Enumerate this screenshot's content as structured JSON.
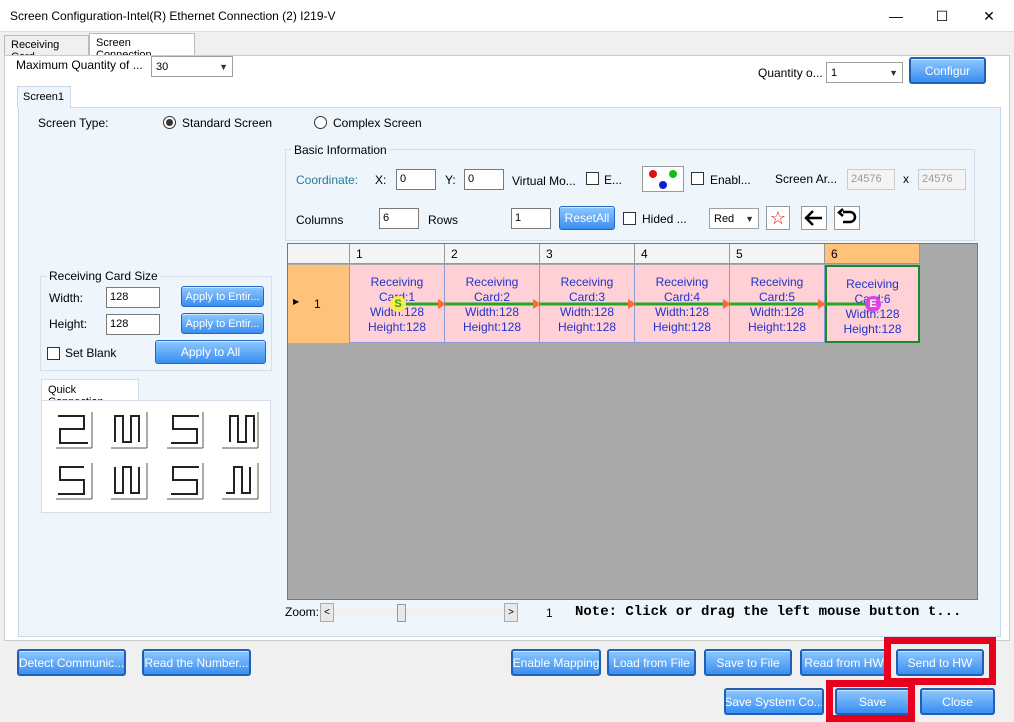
{
  "window": {
    "title": "Screen Configuration-Intel(R) Ethernet Connection (2) I219-V",
    "minimize": "—",
    "maximize": "☐",
    "close": "✕"
  },
  "tabs": [
    "Receiving Card",
    "Screen Connection"
  ],
  "top": {
    "max_qty_label": "Maximum Quantity of ...",
    "max_qty_value": "30",
    "qty_label": "Quantity o...",
    "qty_value": "1",
    "configure": "Configur"
  },
  "screen_tab": "Screen1",
  "screen_type": {
    "label": "Screen Type:",
    "standard": "Standard Screen",
    "complex": "Complex Screen",
    "selected": "standard"
  },
  "basic": {
    "title": "Basic Information",
    "coordinate": "Coordinate:",
    "x_label": "X:",
    "x": "0",
    "y_label": "Y:",
    "y": "0",
    "virtual": "Virtual Mo...",
    "e_label": "E...",
    "enable_label": "Enabl...",
    "screen_area": "Screen Ar...",
    "area_w": "24576",
    "x_sep": "x",
    "area_h": "24576",
    "columns_label": "Columns",
    "columns": "6",
    "rows_label": "Rows",
    "rows": "1",
    "reset_all": "ResetAll",
    "hided": "Hided ...",
    "color": "Red"
  },
  "card_size": {
    "title": "Receiving Card Size",
    "width_label": "Width:",
    "width": "128",
    "height_label": "Height:",
    "height": "128",
    "apply_entire_w": "Apply to Entir...",
    "apply_entire_h": "Apply to Entir...",
    "set_blank": "Set Blank",
    "apply_all": "Apply to All"
  },
  "quick": {
    "title": "Quick Connection"
  },
  "grid": {
    "columns": [
      "1",
      "2",
      "3",
      "4",
      "5",
      "6"
    ],
    "row": "1",
    "cards": [
      {
        "l1": "Receiving",
        "l2": "Card:1",
        "l3": "Width:128",
        "l4": "Height:128"
      },
      {
        "l1": "Receiving",
        "l2": "Card:2",
        "l3": "Width:128",
        "l4": "Height:128"
      },
      {
        "l1": "Receiving",
        "l2": "Card:3",
        "l3": "Width:128",
        "l4": "Height:128"
      },
      {
        "l1": "Receiving",
        "l2": "Card:4",
        "l3": "Width:128",
        "l4": "Height:128"
      },
      {
        "l1": "Receiving",
        "l2": "Card:5",
        "l3": "Width:128",
        "l4": "Height:128"
      },
      {
        "l1": "Receiving",
        "l2": "Card:6",
        "l3": "Width:128",
        "l4": "Height:128"
      }
    ],
    "start_marker": "S",
    "end_marker": "E"
  },
  "zoom": {
    "label": "Zoom:",
    "left": "<",
    "right": ">",
    "value": "1",
    "note": "Note: Click or drag the left mouse button t..."
  },
  "bottom": {
    "detect": "Detect Communic...",
    "read_number": "Read the Number...",
    "enable_mapping": "Enable Mapping",
    "load_file": "Load from File",
    "save_file": "Save to File",
    "read_hw": "Read from HW",
    "send_hw": "Send to HW",
    "save_system": "Save System Co...",
    "save": "Save",
    "close": "Close"
  },
  "colors": {
    "accent": "#3a8ef0",
    "highlight": "#e8001c",
    "card": "#ffd0d6"
  }
}
